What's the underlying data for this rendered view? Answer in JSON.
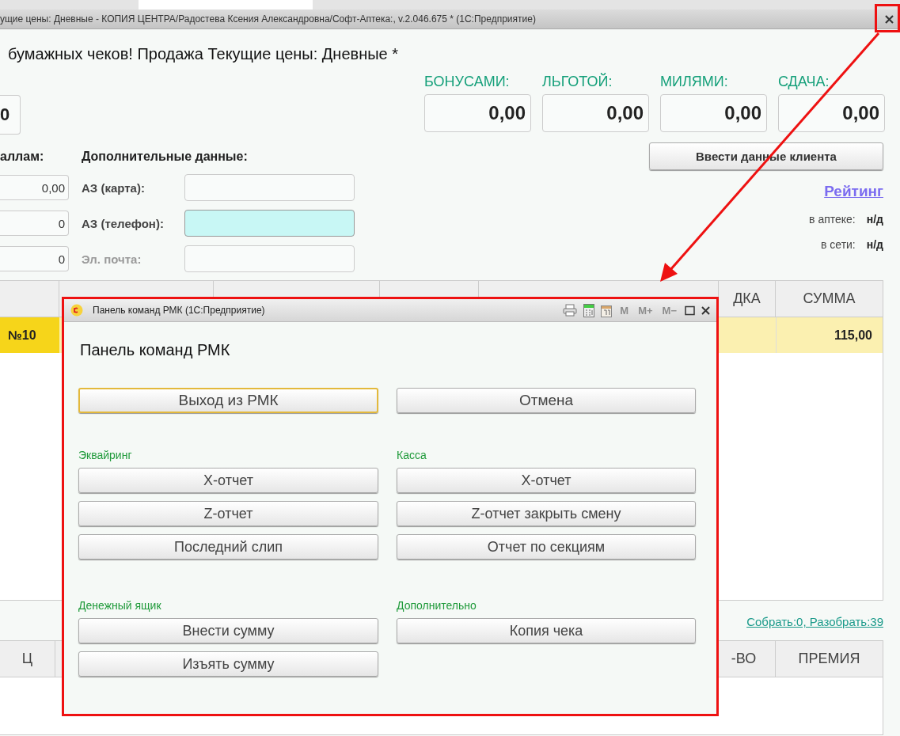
{
  "main_window": {
    "title": "ущие цены: Дневные - КОПИЯ ЦЕНТРА/Радостева Ксения Александровна/Софт-Аптека:, v.2.046.675 *  (1С:Предприятие)",
    "heading": "бумажных чеков! Продажа Текущие цены: Дневные *",
    "left_total": "0",
    "payment_fields": [
      {
        "label": "БОНУСАМИ:",
        "value": "0,00"
      },
      {
        "label": "ЛЬГОТОЙ:",
        "value": "0,00"
      },
      {
        "label": "МИЛЯМИ:",
        "value": "0,00"
      },
      {
        "label": "СДАЧА:",
        "value": "0,00"
      }
    ],
    "points_label": "аллам:",
    "points_fields": [
      "0,00",
      "0",
      "0"
    ],
    "additional_data": {
      "title": "Дополнительные данные:",
      "fields": [
        {
          "label": "АЗ (карта):",
          "disabled": false,
          "focused": false
        },
        {
          "label": "АЗ (телефон):",
          "disabled": false,
          "focused": true
        },
        {
          "label": "Эл. почта:",
          "disabled": true,
          "focused": false
        }
      ]
    },
    "client_button": "Ввести данные клиента",
    "rating_link": "Рейтинг",
    "rating": [
      {
        "label": "в аптеке:",
        "value": "н/д"
      },
      {
        "label": "в сети:",
        "value": "н/д"
      }
    ],
    "table": {
      "columns": [
        "ДКА",
        "СУММА"
      ],
      "rows": [
        {
          "number": "№10",
          "sum": "115,00",
          "selected": true
        }
      ]
    },
    "collect_link": "Собрать:0, Разобрать:39",
    "table_2": {
      "columns": [
        "Ц",
        "-ВО",
        "ПРЕМИЯ"
      ]
    }
  },
  "dialog": {
    "title": "Панель команд РМК  (1С:Предприятие)",
    "memory_buttons": [
      {
        "label": "M",
        "disabled": true
      },
      {
        "label": "M+",
        "disabled": true
      },
      {
        "label": "M−",
        "disabled": true
      }
    ],
    "heading": "Панель команд РМК",
    "top_buttons": [
      {
        "label": "Выход из РМК",
        "selected": true
      },
      {
        "label": "Отмена",
        "selected": false
      }
    ],
    "groups": [
      {
        "title": "Эквайринг",
        "buttons": [
          "X-отчет",
          "Z-отчет",
          "Последний слип"
        ]
      },
      {
        "title": "Касса",
        "buttons": [
          "X-отчет",
          "Z-отчет закрыть смену",
          "Отчет по секциям"
        ]
      },
      {
        "title": "Денежный ящик",
        "buttons": [
          "Внести сумму",
          "Изъять сумму"
        ]
      },
      {
        "title": "Дополнительно",
        "buttons": [
          "Копия чека"
        ]
      }
    ]
  }
}
